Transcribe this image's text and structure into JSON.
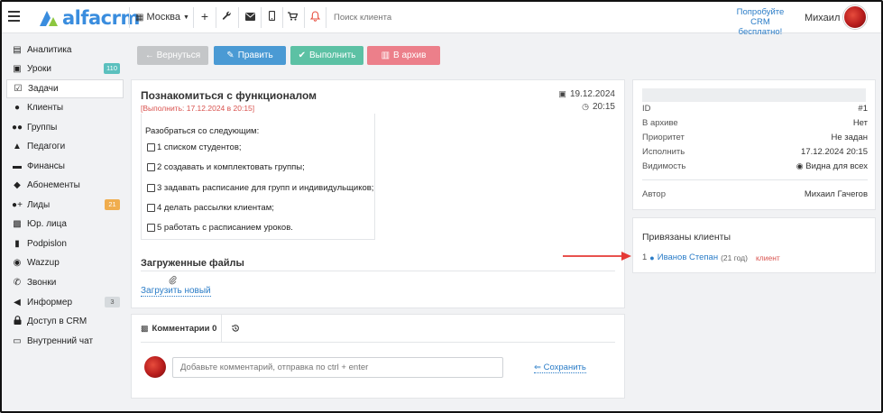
{
  "topbar": {
    "logo_text": "alfacrm",
    "city": "Москва",
    "search_placeholder": "Поиск клиента",
    "promo_line1": "Попробуйте",
    "promo_line2": "CRM бесплатно!",
    "user_name": "Михаил",
    "icons": [
      "menu-icon",
      "building-icon",
      "plus-icon",
      "wrench-icon",
      "envelope-icon",
      "mobile-icon",
      "cart-icon",
      "bell-icon"
    ],
    "bell_color": "#e74c3c"
  },
  "sidebar": {
    "items": [
      {
        "label": "Аналитика",
        "icon": "chart-icon"
      },
      {
        "label": "Уроки",
        "icon": "calendar-icon",
        "badge": "110",
        "badge_color": "#5bc0be"
      },
      {
        "label": "Задачи",
        "icon": "tasks-icon",
        "active": true
      },
      {
        "label": "Клиенты",
        "icon": "user-icon"
      },
      {
        "label": "Группы",
        "icon": "users-icon"
      },
      {
        "label": "Педагоги",
        "icon": "graduation-cap-icon"
      },
      {
        "label": "Финансы",
        "icon": "money-icon"
      },
      {
        "label": "Абонементы",
        "icon": "tag-icon"
      },
      {
        "label": "Лиды",
        "icon": "user-plus-icon",
        "badge": "21",
        "badge_color": "#f0ad4e"
      },
      {
        "label": "Юр. лица",
        "icon": "briefcase-icon"
      },
      {
        "label": "Podpislon",
        "icon": "file-icon"
      },
      {
        "label": "Wazzup",
        "icon": "whatsapp-icon"
      },
      {
        "label": "Звонки",
        "icon": "phone-icon"
      },
      {
        "label": "Информер",
        "icon": "bullhorn-icon",
        "badge": "3",
        "badge_color": "#d6dadd"
      },
      {
        "label": "Доступ в CRM",
        "icon": "lock-icon"
      },
      {
        "label": "Внутренний чат",
        "icon": "chat-icon"
      }
    ]
  },
  "actions": {
    "back": "← Вернуться",
    "edit": "Править",
    "complete": "Выполнить",
    "archive": "В архив",
    "colors": {
      "back": "#c4c6c8",
      "edit": "#4a9ad4",
      "complete": "#5cc1a4",
      "archive": "#ec7f8a"
    }
  },
  "task": {
    "title": "Познакомиться с функционалом",
    "deadline": "[Выполнить: 17.12.2024 в 20:15]",
    "date": "19.12.2024",
    "time": "20:15",
    "intro": "Разобраться со следующим:",
    "checklist": [
      "1 списком студентов;",
      "2 создавать и комплектовать группы;",
      "3 задавать расписание для групп и индивидульщиков;",
      "4 делать рассылки клиентам;",
      "5 работать с расписанием уроков."
    ],
    "files_title": "Загруженные файлы",
    "upload_link": "Загрузить новый"
  },
  "info": {
    "rows": [
      {
        "label": "ID",
        "value": "#1"
      },
      {
        "label": "В архиве",
        "value": "Нет"
      },
      {
        "label": "Приоритет",
        "value": "Не задан"
      },
      {
        "label": "Исполнить",
        "value": "17.12.2024 20:15"
      },
      {
        "label": "Видимость",
        "value": "Видна для всех"
      }
    ],
    "author_label": "Автор",
    "author_value": "Михаил Гачегов"
  },
  "clients": {
    "title": "Привязаны клиенты",
    "index": "1",
    "name": "Иванов Степан",
    "age": "(21 год)",
    "type": "клиент",
    "arrow_color": "#e53935"
  },
  "comments": {
    "tab_label": "Комментарии 0",
    "placeholder": "Добавьте комментарий, отправка по ctrl + enter",
    "save_label": "Сохранить"
  }
}
